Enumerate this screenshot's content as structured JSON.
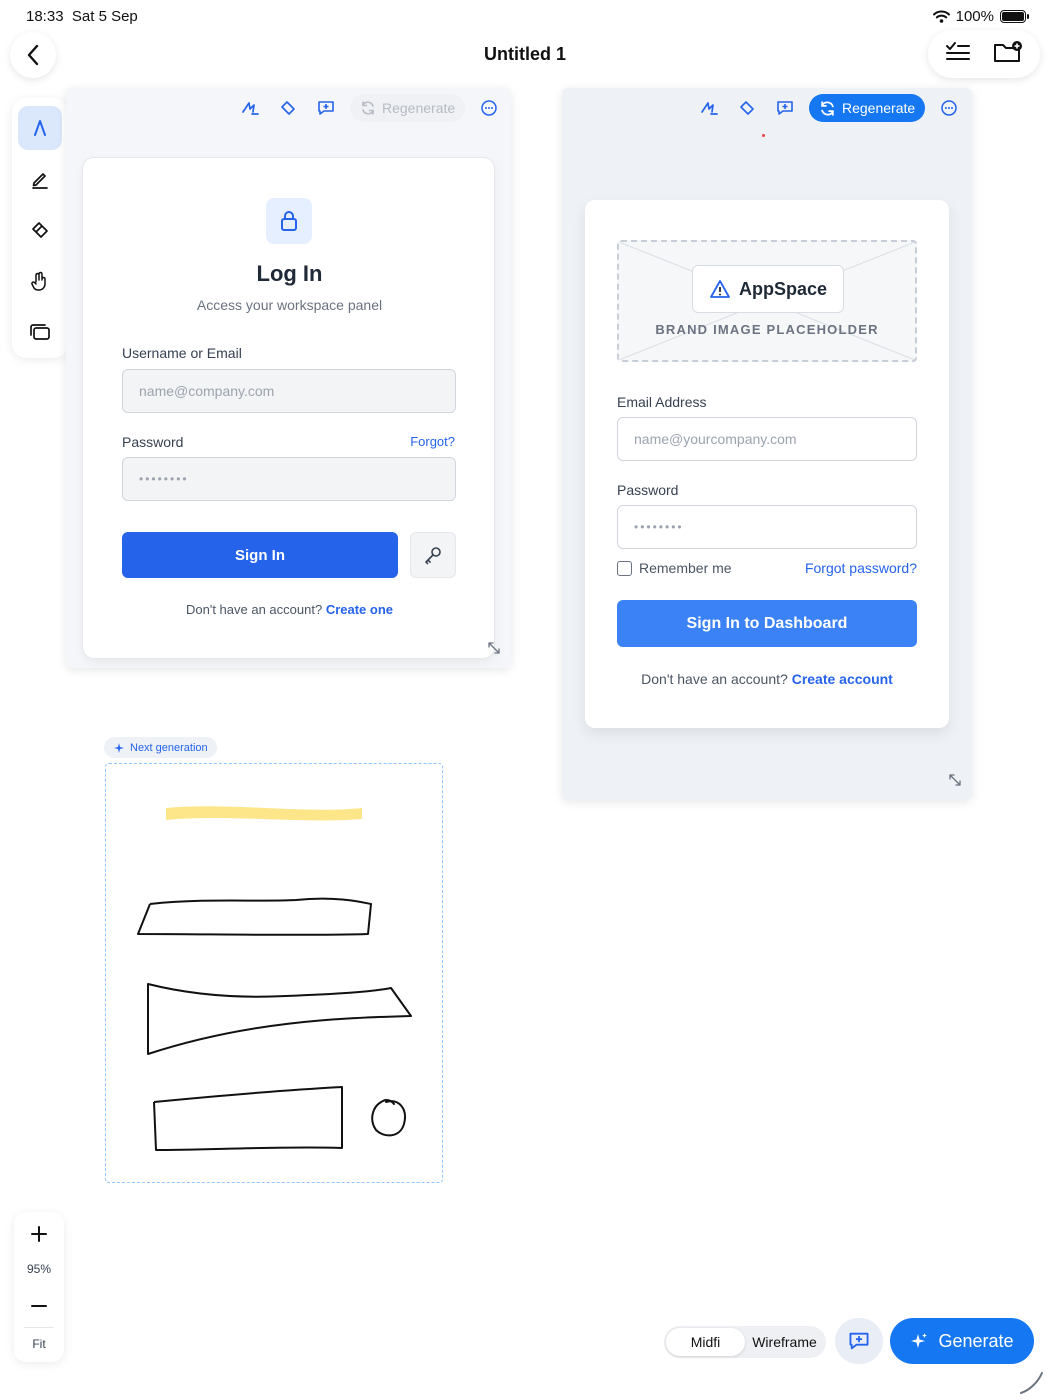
{
  "status_bar": {
    "time": "18:33",
    "date": "Sat 5 Sep",
    "battery": "100%",
    "battery_level": 1.0
  },
  "header": {
    "title": "Untitled 1"
  },
  "toolbar_icons": [
    "back-icon",
    "checklist-icon",
    "folder-add-icon"
  ],
  "tools": [
    "pointer-icon",
    "pencil-icon",
    "eraser-icon",
    "hand-icon",
    "frames-icon"
  ],
  "frame_a": {
    "regenerate_label": "Regenerate",
    "card": {
      "title": "Log In",
      "subtitle": "Access your workspace panel",
      "username_label": "Username or Email",
      "username_placeholder": "name@company.com",
      "password_label": "Password",
      "password_value": "••••••••",
      "forgot_label": "Forgot?",
      "sign_in_label": "Sign In",
      "footer_text": "Don't have an account?",
      "footer_link": "Create one"
    }
  },
  "frame_b": {
    "regenerate_label": "Regenerate",
    "card": {
      "brand_name": "AppSpace",
      "brand_caption": "BRAND IMAGE PLACEHOLDER",
      "email_label": "Email Address",
      "email_placeholder": "name@yourcompany.com",
      "password_label": "Password",
      "password_value": "••••••••",
      "remember_label": "Remember me",
      "forgot_label": "Forgot password?",
      "sign_in_label": "Sign In to Dashboard",
      "footer_text": "Don't have an account?",
      "footer_link": "Create account"
    }
  },
  "next_generation": {
    "label": "Next generation",
    "highlight_color": "#fde68a"
  },
  "zoom": {
    "level": "95%",
    "fit_label": "Fit"
  },
  "bottom": {
    "modes": [
      "Midfi",
      "Wireframe"
    ],
    "selected_mode": "Midfi",
    "generate_label": "Generate"
  },
  "colors": {
    "accent": "#1677f2",
    "primary_button": "#2563eb",
    "secondary_button": "#3b82f6"
  }
}
